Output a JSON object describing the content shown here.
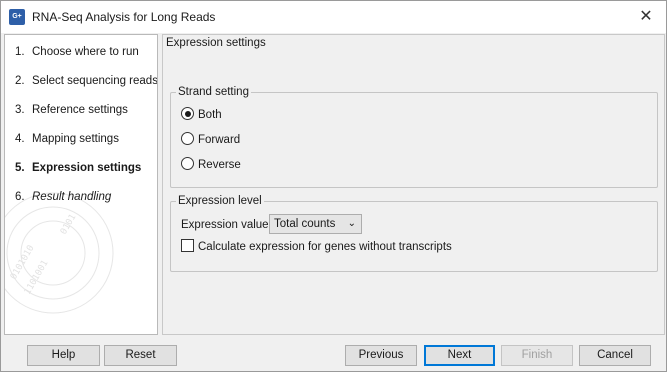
{
  "window": {
    "title": "RNA-Seq Analysis for Long Reads",
    "icon_text": "G+",
    "close_glyph": "✕"
  },
  "steps": [
    {
      "num": "1.",
      "label": "Choose where to run",
      "state": "done"
    },
    {
      "num": "2.",
      "label": "Select sequencing reads",
      "state": "done"
    },
    {
      "num": "3.",
      "label": "Reference settings",
      "state": "done"
    },
    {
      "num": "4.",
      "label": "Mapping settings",
      "state": "done"
    },
    {
      "num": "5.",
      "label": "Expression settings",
      "state": "active"
    },
    {
      "num": "6.",
      "label": "Result handling",
      "state": "future"
    }
  ],
  "content": {
    "title": "Expression settings",
    "strand": {
      "legend": "Strand setting",
      "options": [
        "Both",
        "Forward",
        "Reverse"
      ],
      "selected": "Both"
    },
    "expression": {
      "legend": "Expression level",
      "value_label": "Expression value",
      "value_selected": "Total counts",
      "checkbox_label": "Calculate expression for genes without transcripts",
      "checkbox_checked": false
    }
  },
  "buttons": {
    "help": "Help",
    "reset": "Reset",
    "previous": "Previous",
    "next": "Next",
    "finish": "Finish",
    "cancel": "Cancel"
  },
  "colors": {
    "accent": "#0078d7",
    "app_icon": "#2e5fa8"
  }
}
